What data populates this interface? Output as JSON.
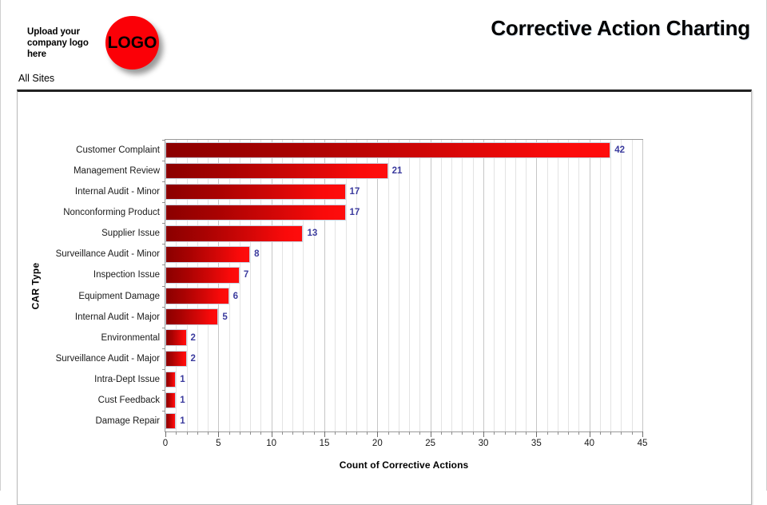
{
  "header": {
    "logo_caption": "Upload your company logo here",
    "logo_text": "LOGO",
    "page_title": "Corrective Action Charting"
  },
  "site_selector": {
    "label": "All Sites"
  },
  "colors": {
    "bar_dark": "#8B0000",
    "bar_bright": "#FF0D0D",
    "value_label": "#3B3B9E",
    "logo_red": "#FB0007",
    "gridline": "#E3E3E3",
    "axis": "#9A9A9A"
  },
  "chart_data": {
    "type": "bar",
    "orientation": "horizontal",
    "title": "",
    "xlabel": "Count of Corrective Actions",
    "ylabel": "CAR Type",
    "xlim": [
      0,
      45
    ],
    "xticks": [
      0,
      5,
      10,
      15,
      20,
      25,
      30,
      35,
      40,
      45
    ],
    "xtick_labels": [
      "0",
      "5",
      "10",
      "15",
      "20",
      "25",
      "30",
      "35",
      "40",
      "45"
    ],
    "minor_tick_step": 1,
    "grid": true,
    "legend": false,
    "data_labels": true,
    "categories": [
      "Customer Complaint",
      "Management Review",
      "Internal Audit - Minor",
      "Nonconforming Product",
      "Supplier Issue",
      "Surveillance Audit - Minor",
      "Inspection Issue",
      "Equipment Damage",
      "Internal Audit - Major",
      "Environmental",
      "Surveillance Audit - Major",
      "Intra-Dept Issue",
      "Cust Feedback",
      "Damage Repair"
    ],
    "values": [
      42,
      21,
      17,
      17,
      13,
      8,
      7,
      6,
      5,
      2,
      2,
      1,
      1,
      1
    ]
  }
}
